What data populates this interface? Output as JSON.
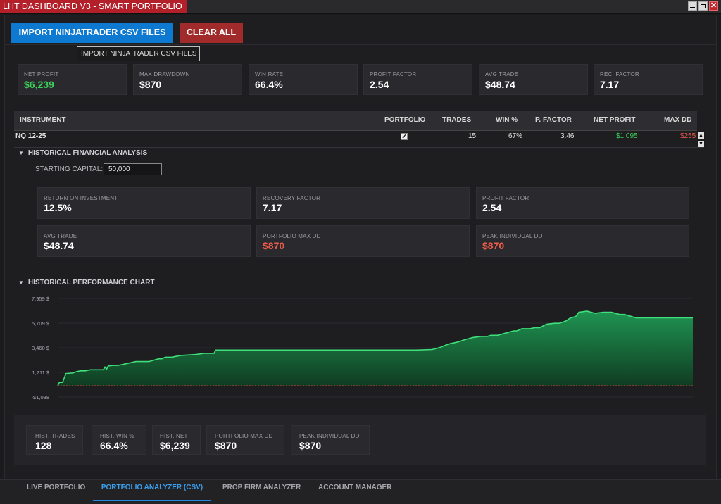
{
  "app": {
    "title": "LHT DASHBOARD V3 - SMART PORTFOLIO"
  },
  "window": {
    "minimize": "",
    "maximize": "",
    "close": "✕"
  },
  "toolbar": {
    "import_label": "IMPORT NINJATRADER CSV FILES",
    "clear_label": "CLEAR ALL",
    "tooltip": "IMPORT NINJATRADER CSV FILES"
  },
  "summary": [
    {
      "label": "NET PROFIT",
      "value": "$6,239"
    },
    {
      "label": "MAX DRAWDOWN",
      "value": "$870"
    },
    {
      "label": "WIN RATE",
      "value": "66.4%"
    },
    {
      "label": "PROFIT FACTOR",
      "value": "2.54"
    },
    {
      "label": "AVG TRADE",
      "value": "$48.74"
    },
    {
      "label": "REC. FACTOR",
      "value": "7.17"
    }
  ],
  "table": {
    "headers": [
      "INSTRUMENT",
      "PORTFOLIO",
      "TRADES",
      "WIN %",
      "P. FACTOR",
      "NET PROFIT",
      "MAX DD"
    ],
    "rows": [
      {
        "instrument": "NQ 12-25",
        "portfolio": "✓",
        "trades": "15",
        "win": "67%",
        "pfactor": "3.46",
        "net": "$1,095",
        "maxdd": "$255"
      }
    ]
  },
  "analysis": {
    "section_title": "HISTORICAL FINANCIAL ANALYSIS",
    "starting_capital_label": "STARTING CAPITAL:",
    "starting_capital_value": "50,000",
    "cards": [
      {
        "label": "RETURN ON INVESTMENT",
        "value": "12.5%"
      },
      {
        "label": "RECOVERY FACTOR",
        "value": "7.17"
      },
      {
        "label": "PROFIT FACTOR",
        "value": "2.54"
      },
      {
        "label": "AVG TRADE",
        "value": "$48.74"
      },
      {
        "label": "PORTFOLIO MAX DD",
        "value": "$870"
      },
      {
        "label": "PEAK INDIVIDUAL DD",
        "value": "$870"
      }
    ]
  },
  "chart_section": {
    "title": "HISTORICAL PERFORMANCE CHART"
  },
  "chart_data": {
    "type": "area",
    "title": "",
    "xlabel": "",
    "ylabel": "",
    "y_tick_labels": [
      "7,959 $",
      "5,709 $",
      "3,460 $",
      "1,211 $",
      "-$1,038"
    ],
    "y_ticks": [
      7959,
      5709,
      3460,
      1211,
      -1038
    ],
    "ylim": [
      -1038,
      7959
    ],
    "baseline": 0,
    "grid": true,
    "x": [
      0,
      1,
      2,
      3,
      5,
      8,
      9,
      10,
      11,
      12,
      14,
      17,
      20,
      24,
      28,
      29,
      30,
      31,
      34,
      37,
      42,
      48,
      56,
      62,
      64,
      66,
      70,
      75,
      80,
      85,
      90,
      96,
      97,
      98,
      99,
      100,
      103,
      110,
      115,
      120,
      130,
      140,
      145,
      150,
      170,
      180,
      190,
      200,
      210,
      220,
      230,
      235,
      240,
      243,
      246,
      250,
      255,
      260,
      264,
      266,
      270,
      275,
      280,
      282,
      285,
      290,
      293,
      296,
      300,
      305,
      308,
      312,
      315,
      318,
      320,
      325,
      330,
      335,
      338,
      340,
      345,
      348,
      355,
      365,
      380,
      390
    ],
    "values": [
      0,
      300,
      300,
      300,
      1100,
      1150,
      1150,
      1200,
      1250,
      1300,
      1350,
      1350,
      1450,
      1450,
      1450,
      1700,
      1500,
      1800,
      1850,
      1850,
      2000,
      2200,
      2200,
      2450,
      2450,
      2600,
      2600,
      2750,
      2800,
      2850,
      2950,
      2950,
      3250,
      3250,
      3250,
      3250,
      3250,
      3250,
      3250,
      3250,
      3250,
      3250,
      3250,
      3250,
      3250,
      3250,
      3250,
      3250,
      3250,
      3250,
      3300,
      3500,
      3800,
      3900,
      4000,
      4200,
      4400,
      4500,
      4500,
      4600,
      4600,
      4800,
      5000,
      5000,
      5200,
      5200,
      5300,
      5300,
      5600,
      5700,
      5700,
      5900,
      6200,
      6300,
      6700,
      6800,
      6600,
      6700,
      6700,
      6700,
      6500,
      6500,
      6200,
      6200,
      6200,
      6200
    ]
  },
  "stats": [
    {
      "label": "HIST. TRADES",
      "value": "128"
    },
    {
      "label": "HIST. WIN %",
      "value": "66.4%"
    },
    {
      "label": "HIST. NET",
      "value": "$6,239"
    },
    {
      "label": "PORTFOLIO MAX DD",
      "value": "$870"
    },
    {
      "label": "PEAK INDIVIDUAL DD",
      "value": "$870"
    }
  ],
  "tabs": [
    {
      "label": "LIVE PORTFOLIO"
    },
    {
      "label": "PORTFOLIO ANALYZER (CSV)"
    },
    {
      "label": "PROP FIRM ANALYZER"
    },
    {
      "label": "ACCOUNT MANAGER"
    }
  ],
  "colors": {
    "accent": "#0e79d1",
    "danger": "#a12a2a",
    "profit": "#3ccf5a",
    "loss": "#ee5b4a",
    "chart_line": "#3fe07a"
  }
}
